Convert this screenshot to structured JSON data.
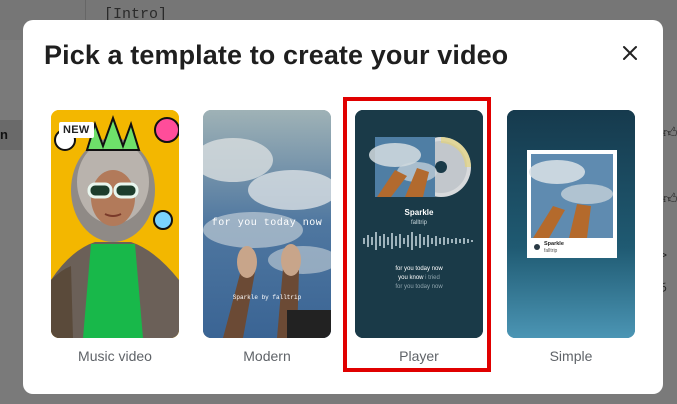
{
  "background": {
    "intro_text": "[Intro]",
    "left_char": "n"
  },
  "modal": {
    "title": "Pick a template to create your video",
    "close_icon": "close-icon"
  },
  "templates": [
    {
      "label": "Music video",
      "badge": "NEW"
    },
    {
      "label": "Modern",
      "overlay_text": "for you today now",
      "caption": "Sparkle by falltrip"
    },
    {
      "label": "Player",
      "song_title": "Sparkle",
      "artist": "falltrip",
      "lyrics": [
        "for you today now",
        "you know",
        "i tried",
        "for you today now"
      ]
    },
    {
      "label": "Simple",
      "song_title": "Sparkle",
      "artist": "falltrip"
    }
  ],
  "colors": {
    "highlight": "#e00000",
    "player_bg": "#1a3a48"
  }
}
